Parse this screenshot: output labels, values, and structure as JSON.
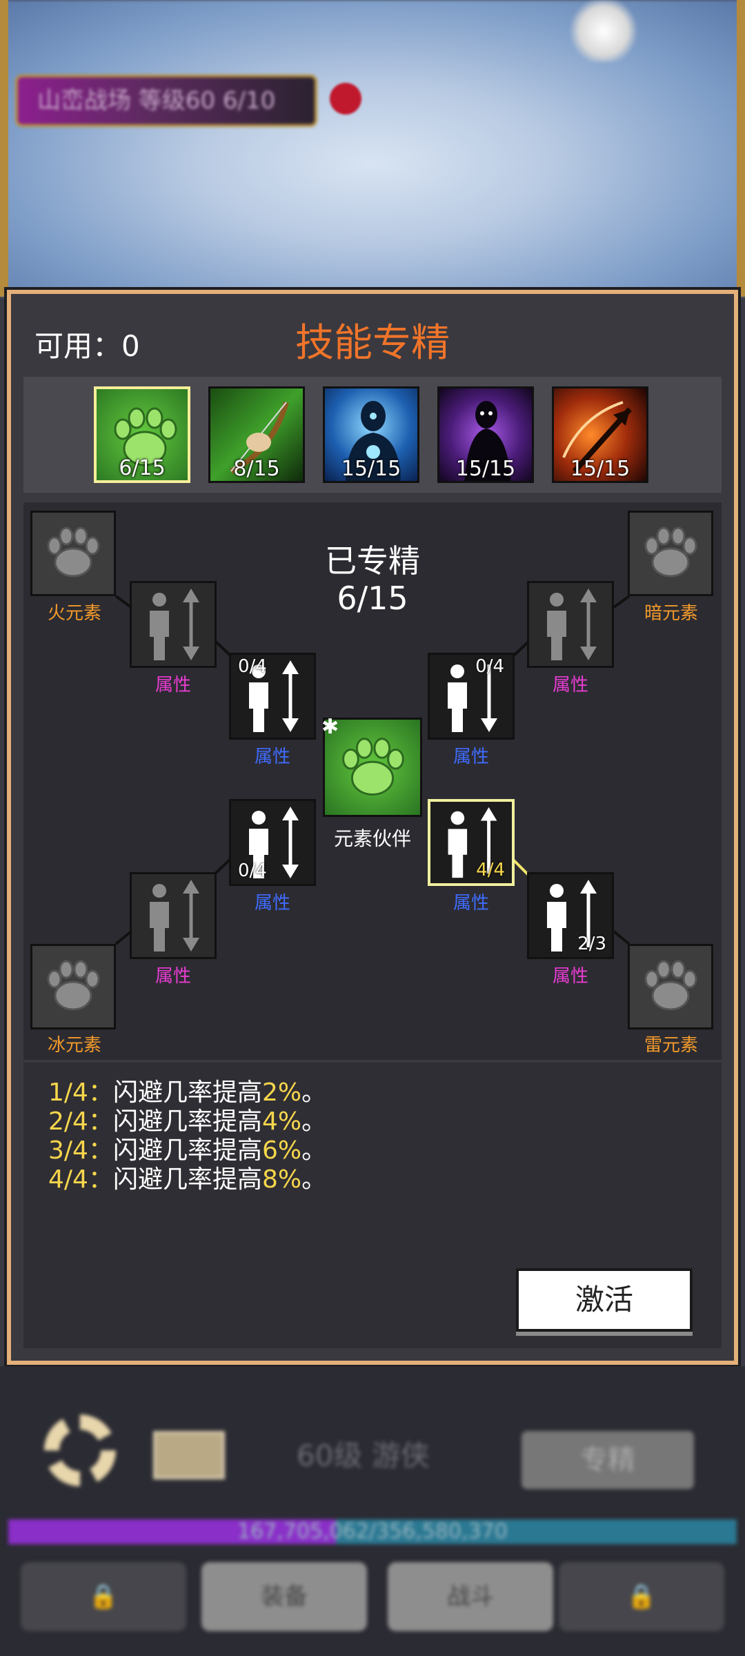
{
  "background": {
    "quest_text": "山峦战场 等级60  6/10",
    "alert_mark": "!"
  },
  "panel": {
    "available_label": "可用：",
    "available_value": "0",
    "title": "技能专精",
    "skill_tabs": [
      {
        "count": "6/15",
        "selected": true,
        "icon": "paw-icon"
      },
      {
        "count": "8/15",
        "selected": false,
        "icon": "bow-icon"
      },
      {
        "count": "15/15",
        "selected": false,
        "icon": "spirit-icon"
      },
      {
        "count": "15/15",
        "selected": false,
        "icon": "shadow-icon"
      },
      {
        "count": "15/15",
        "selected": false,
        "icon": "arrow-icon"
      }
    ],
    "spec_heading": "已专精",
    "spec_progress": "6/15",
    "center_node_label": "元素伙伴",
    "center_node_mark": "✱",
    "elements": {
      "fire": "火元素",
      "dark": "暗元素",
      "ice": "冰元素",
      "thunder": "雷元素"
    },
    "attr_label": "属性",
    "nodes": {
      "upper_left_inner": "0/4",
      "upper_right_inner": "0/4",
      "lower_left_inner": "0/4",
      "lower_right_inner": "4/4",
      "lower_right_outer": "2/3"
    },
    "description": [
      {
        "level": "1/4：",
        "text": "闪避几率提高",
        "value": "2%",
        "end": "。"
      },
      {
        "level": "2/4：",
        "text": "闪避几率提高",
        "value": "4%",
        "end": "。"
      },
      {
        "level": "3/4：",
        "text": "闪避几率提高",
        "value": "6%",
        "end": "。"
      },
      {
        "level": "4/4：",
        "text": "闪避几率提高",
        "value": "8%",
        "end": "。"
      }
    ],
    "activate_button": "激活"
  },
  "hud": {
    "level_class": "60级  游侠",
    "spec_button": "专精",
    "xp_text": "167,705,062/356,580,370",
    "xp_fraction": 0.45,
    "tabs": [
      "装备",
      "战斗"
    ]
  },
  "colors": {
    "title_orange": "#f0742a",
    "gold_text": "#f6d64c",
    "magenta_label": "#e83cd3",
    "blue_label": "#3f6cff",
    "panel_border": "#e4b07a"
  }
}
